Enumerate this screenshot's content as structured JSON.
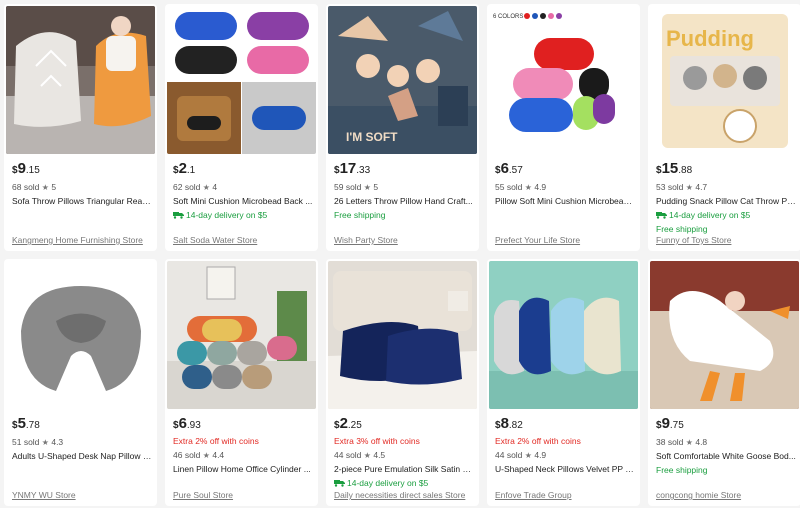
{
  "products": [
    {
      "price": {
        "currency": "$",
        "int": "9",
        "dec": ".15"
      },
      "promo": "",
      "sold": "68 sold",
      "rating": "5",
      "title": "Sofa Throw Pillows Triangular Read...",
      "delivery": "",
      "free_shipping": "",
      "store": "Kangmeng Home Furnishing Store"
    },
    {
      "price": {
        "currency": "$",
        "int": "2",
        "dec": ".1"
      },
      "promo": "",
      "sold": "62 sold",
      "rating": "4",
      "title": "Soft Mini Cushion Microbead Back ...",
      "delivery": "14-day delivery on $5",
      "free_shipping": "",
      "store": "Salt Soda Water Store"
    },
    {
      "price": {
        "currency": "$",
        "int": "17",
        "dec": ".33"
      },
      "promo": "",
      "sold": "59 sold",
      "rating": "5",
      "title": "26 Letters Throw Pillow Hand Craft...",
      "delivery": "",
      "free_shipping": "Free shipping",
      "store": "Wish Party Store"
    },
    {
      "price": {
        "currency": "$",
        "int": "6",
        "dec": ".57"
      },
      "promo": "",
      "sold": "55 sold",
      "rating": "4.9",
      "title": "Pillow Soft Mini Cushion Microbead...",
      "delivery": "",
      "free_shipping": "",
      "store": "Prefect Your Life Store"
    },
    {
      "price": {
        "currency": "$",
        "int": "15",
        "dec": ".88"
      },
      "promo": "",
      "sold": "53 sold",
      "rating": "4.7",
      "title": "Pudding Snack Pillow Cat Throw Pill...",
      "delivery": "14-day delivery on $5",
      "free_shipping": "Free shipping",
      "store": "Funny of Toys Store"
    },
    {
      "price": {
        "currency": "$",
        "int": "5",
        "dec": ".78"
      },
      "promo": "",
      "sold": "51 sold",
      "rating": "4.3",
      "title": "Adults U-Shaped Desk Nap Pillow f...",
      "delivery": "",
      "free_shipping": "",
      "store": "YNMY WU Store"
    },
    {
      "price": {
        "currency": "$",
        "int": "6",
        "dec": ".93"
      },
      "promo": "Extra 2% off with coins",
      "sold": "46 sold",
      "rating": "4.4",
      "title": "Linen Pillow Home Office Cylinder ...",
      "delivery": "",
      "free_shipping": "",
      "store": "Pure Soul Store"
    },
    {
      "price": {
        "currency": "$",
        "int": "2",
        "dec": ".25"
      },
      "promo": "Extra 3% off with coins",
      "sold": "44 sold",
      "rating": "4.5",
      "title": "2-piece Pure Emulation Silk Satin Pi...",
      "delivery": "14-day delivery on $5",
      "free_shipping": "",
      "store": "Daily necessities direct sales Store"
    },
    {
      "price": {
        "currency": "$",
        "int": "8",
        "dec": ".82"
      },
      "promo": "Extra 2% off with coins",
      "sold": "44 sold",
      "rating": "4.9",
      "title": "U-Shaped Neck Pillows Velvet PP Fil...",
      "delivery": "",
      "free_shipping": "",
      "store": "Enfove Trade Group"
    },
    {
      "price": {
        "currency": "$",
        "int": "9",
        "dec": ".75"
      },
      "promo": "",
      "sold": "38 sold",
      "rating": "4.8",
      "title": "Soft Comfortable White Goose Bod...",
      "delivery": "",
      "free_shipping": "Free shipping",
      "store": "congcong homie Store"
    }
  ],
  "image_labels": {
    "colors_badge": "6 COLORS",
    "pudding_text": "Pudding",
    "letter_art": "I'M SOFT"
  },
  "colors": {
    "price": "#222222",
    "promo": "#e22a24",
    "delivery": "#1a9e3f",
    "store": "#777777"
  }
}
